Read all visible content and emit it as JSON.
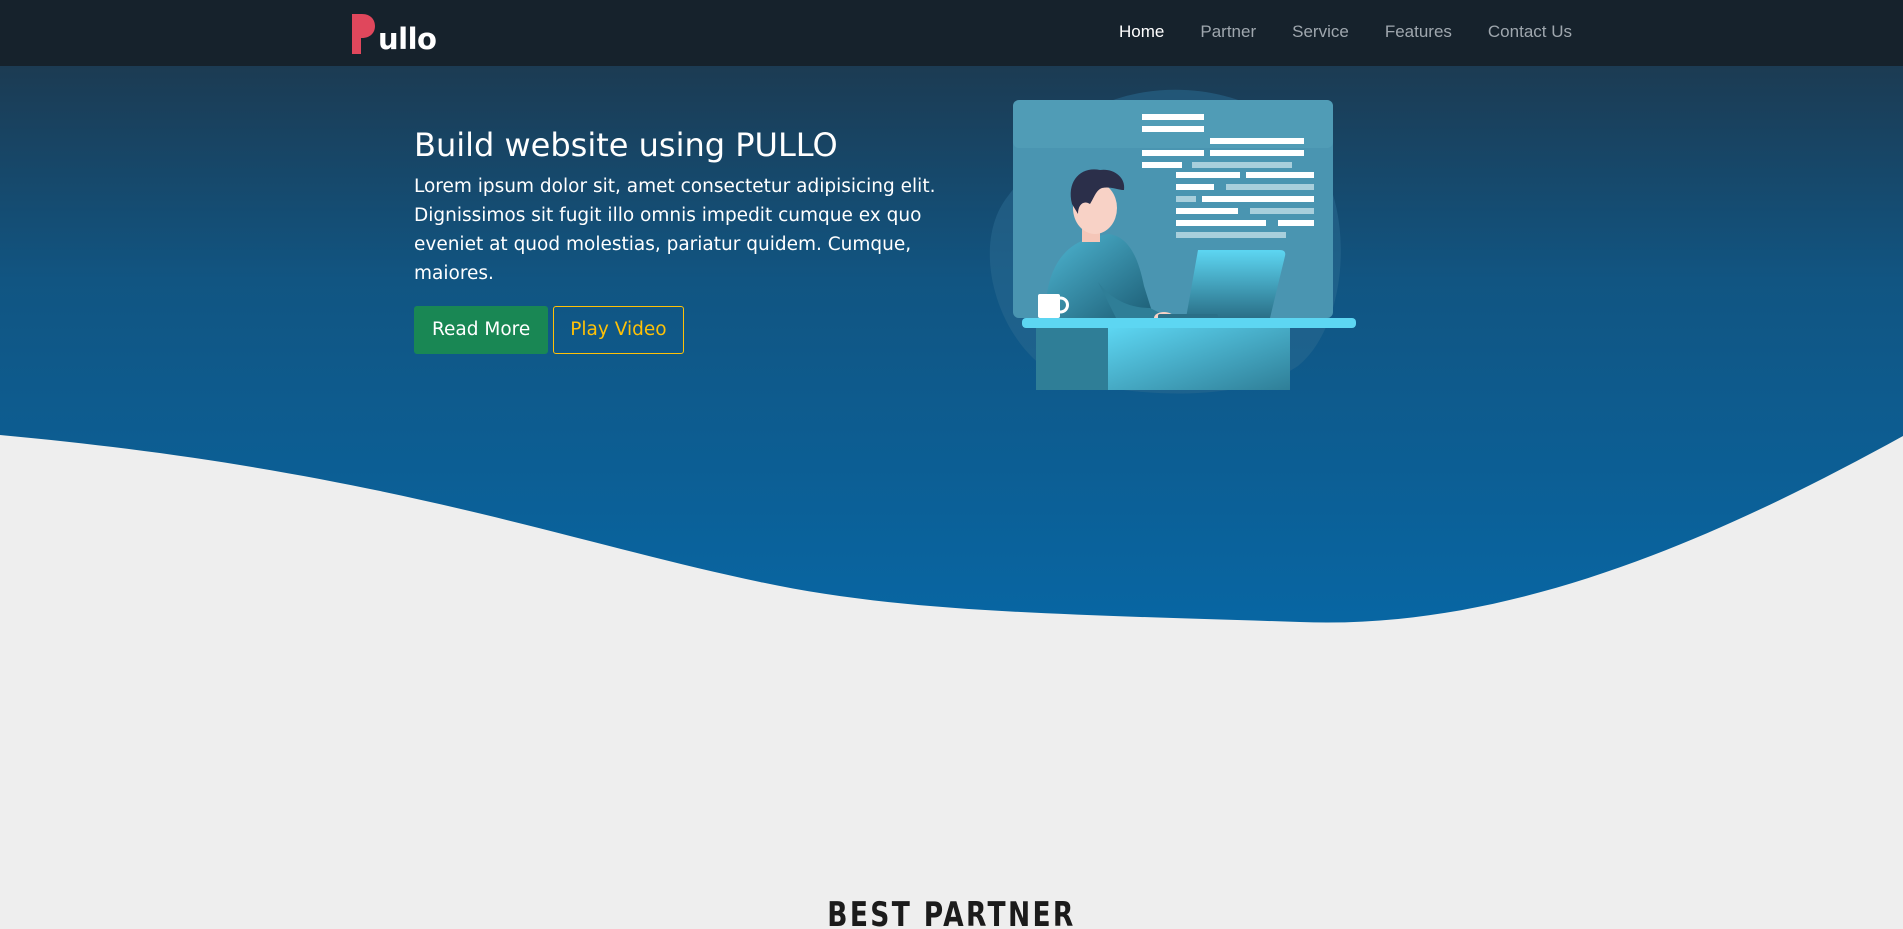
{
  "nav": {
    "logo_text": "ullo",
    "logo_full": "Pullo",
    "links": [
      "Home",
      "Partner",
      "Service",
      "Features",
      "Contact Us"
    ],
    "active_index": 0
  },
  "hero": {
    "title": "Build website using PULLO",
    "description": "Lorem ipsum dolor sit, amet consectetur adipisicing elit. Dignissimos sit fugit illo omnis impedit cumque ex quo eveniet at quod molestias, pariatur quidem. Cumque, maiores.",
    "read_more_label": "Read More",
    "play_video_label": "Play Video"
  },
  "section": {
    "title": "BEST PARTNER"
  },
  "colors": {
    "navbar": "#16222c",
    "hero_top": "#1f3344",
    "hero_bottom": "#0a64a0",
    "page_bg": "#eeeeee",
    "logo_accent": "#e0475c",
    "read_more_bg": "#198754",
    "play_video_border": "#ffc107",
    "illustration_panel": "#4a95b1",
    "illustration_accent": "#5dd6f2"
  },
  "icons": {
    "logo": "pullo-logo",
    "illustration": "developer-at-laptop-illustration"
  }
}
